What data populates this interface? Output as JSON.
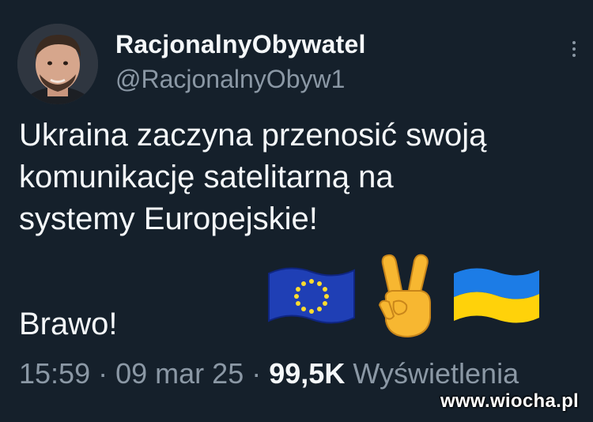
{
  "author": {
    "display_name": "RacjonalnyObywatel",
    "handle": "@RacjonalnyObyw1"
  },
  "tweet": {
    "lines": [
      "Ukraina zaczyna przenosić swoją",
      "komunikację satelitarną na",
      "systemy Europejskie!"
    ],
    "closing": "Brawo!",
    "emojis": [
      "eu-flag-icon",
      "victory-hand-icon",
      "ukraine-flag-icon"
    ]
  },
  "meta": {
    "time": "15:59",
    "separator": "·",
    "date": "09 mar 25",
    "views_count": "99,5K",
    "views_label": "Wyświetlenia"
  },
  "watermark": "www.wiocha.pl",
  "colors": {
    "background": "#15202b",
    "text_primary": "#f5f8fa",
    "text_secondary": "#8b98a5"
  }
}
